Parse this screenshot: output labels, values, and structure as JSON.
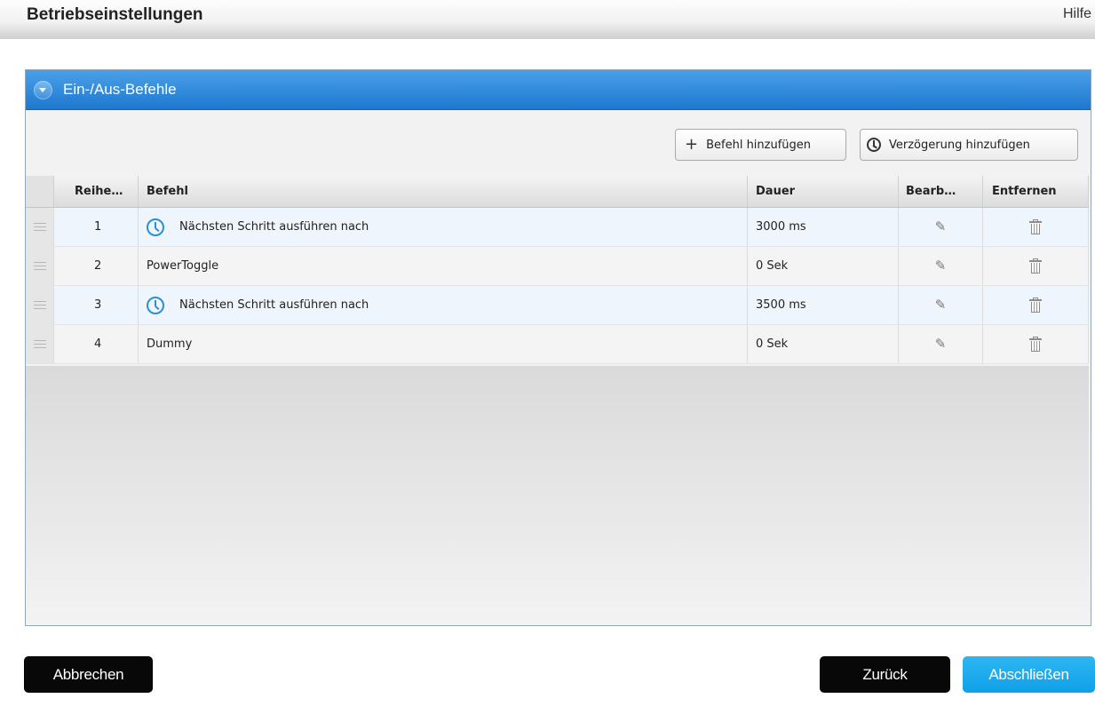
{
  "header": {
    "title": "Betriebseinstellungen",
    "help_label": "Hilfe"
  },
  "panel": {
    "title": "Ein-/Aus-Befehle",
    "add_command_label": "Befehl hinzufügen",
    "add_delay_label": "Verzögerung hinzufügen"
  },
  "table": {
    "columns": [
      "Reihe…",
      "Befehl",
      "Dauer",
      "Bearb…",
      "Entfernen"
    ],
    "rows": [
      {
        "order": "1",
        "command": "Nächsten Schritt ausführen nach",
        "duration": "3000 ms",
        "icon": "clock-icon"
      },
      {
        "order": "2",
        "command": "PowerToggle",
        "duration": "0 Sek",
        "icon": ""
      },
      {
        "order": "3",
        "command": "Nächsten Schritt ausführen nach",
        "duration": "3500 ms",
        "icon": "clock-icon"
      },
      {
        "order": "4",
        "command": "Dummy",
        "duration": "0 Sek",
        "icon": ""
      }
    ]
  },
  "footer": {
    "cancel_label": "Abbrechen",
    "back_label": "Zurück",
    "finish_label": "Abschließen"
  },
  "colors": {
    "panel_header": "#2a84d8",
    "finish_button": "#1aa8ee",
    "dark_button": "#080808",
    "clock_icon": "#2b8fd8"
  }
}
